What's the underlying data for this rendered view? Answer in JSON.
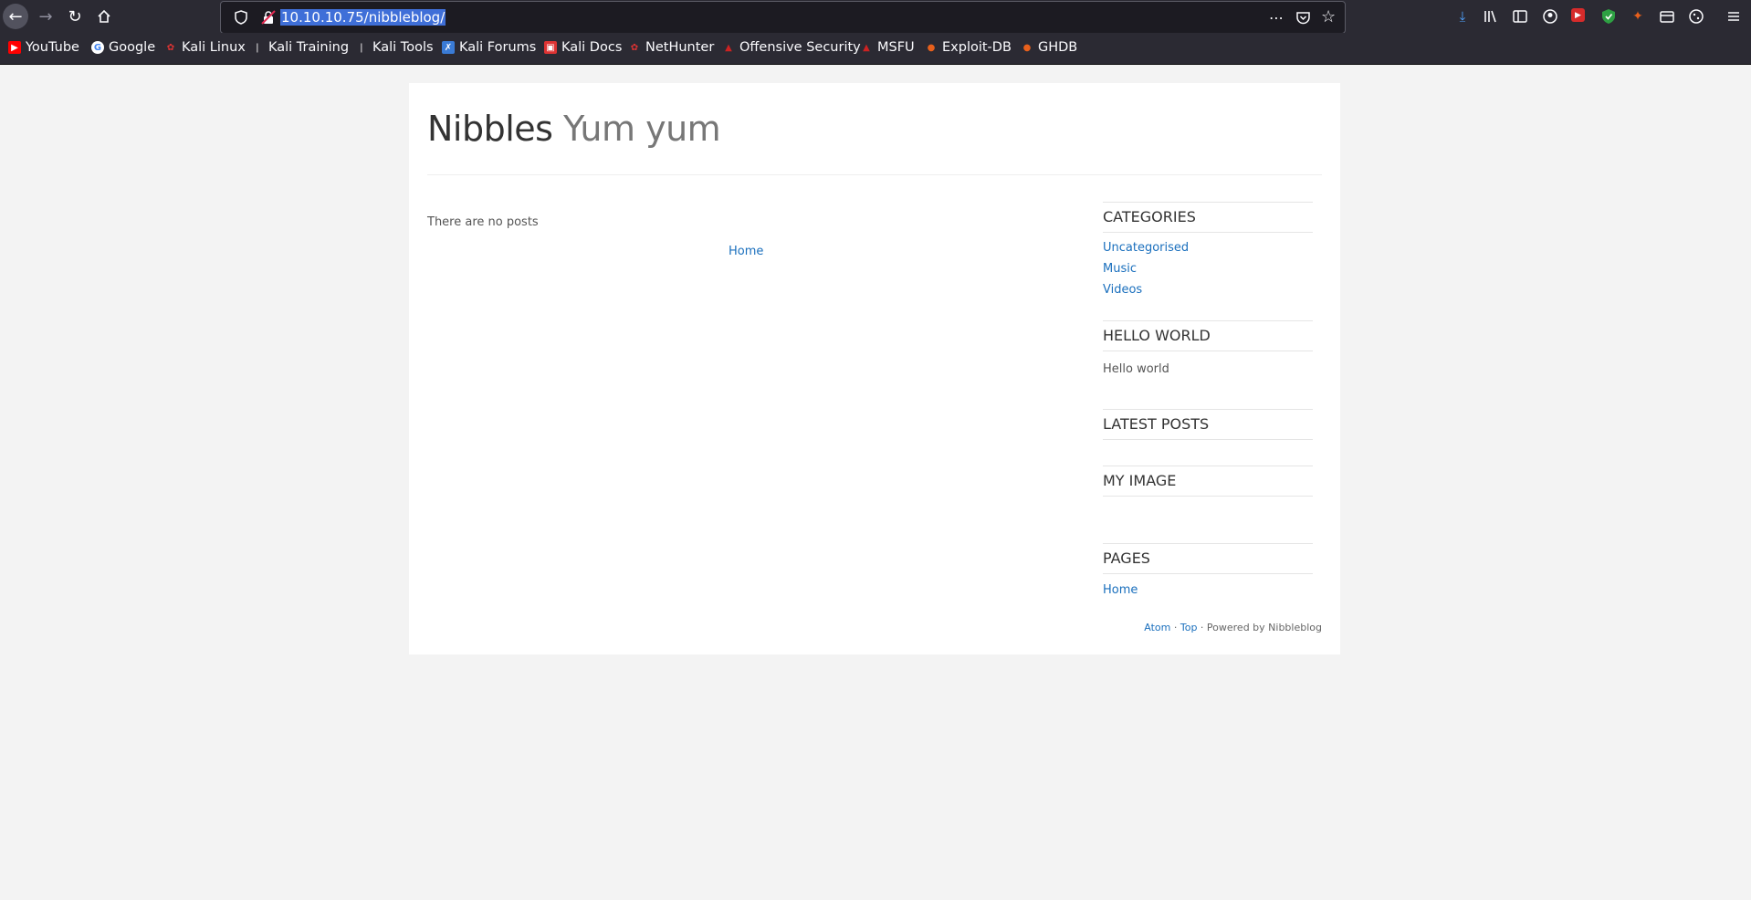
{
  "browser": {
    "url": "10.10.10.75/nibbleblog/",
    "bookmarks": [
      {
        "label": "YouTube",
        "icon": "youtube-icon",
        "color": "#ff0000"
      },
      {
        "label": "Google",
        "icon": "google-icon",
        "color": "#ffffff"
      },
      {
        "label": "Kali Linux",
        "icon": "kali-icon",
        "color": "#d33"
      },
      {
        "label": "Kali Training",
        "icon": "kali-dragon-icon",
        "color": "#ffffff"
      },
      {
        "label": "Kali Tools",
        "icon": "kali-dragon-icon",
        "color": "#ffffff"
      },
      {
        "label": "Kali Forums",
        "icon": "kali-forums-icon",
        "color": "#3a7bd5"
      },
      {
        "label": "Kali Docs",
        "icon": "kali-docs-icon",
        "color": "#d33"
      },
      {
        "label": "NetHunter",
        "icon": "nethunter-icon",
        "color": "#d33"
      },
      {
        "label": "Offensive Security",
        "icon": "offsec-icon",
        "color": "#c22"
      },
      {
        "label": "MSFU",
        "icon": "offsec-icon",
        "color": "#c22"
      },
      {
        "label": "Exploit-DB",
        "icon": "exploitdb-icon",
        "color": "#e8601c"
      },
      {
        "label": "GHDB",
        "icon": "exploitdb-icon",
        "color": "#e8601c"
      }
    ]
  },
  "blog": {
    "name": "Nibbles",
    "slogan": "Yum yum",
    "no_posts": "There are no posts",
    "pager_home": "Home"
  },
  "sidebar": {
    "categories_title": "CATEGORIES",
    "categories": [
      "Uncategorised",
      "Music",
      "Videos"
    ],
    "hello_title": "HELLO WORLD",
    "hello_text": "Hello world",
    "latest_title": "LATEST POSTS",
    "image_title": "MY IMAGE",
    "pages_title": "PAGES",
    "pages": [
      "Home"
    ]
  },
  "footer": {
    "atom": "Atom",
    "sep1": " · ",
    "top": "Top",
    "powered": " · Powered by Nibbleblog"
  }
}
